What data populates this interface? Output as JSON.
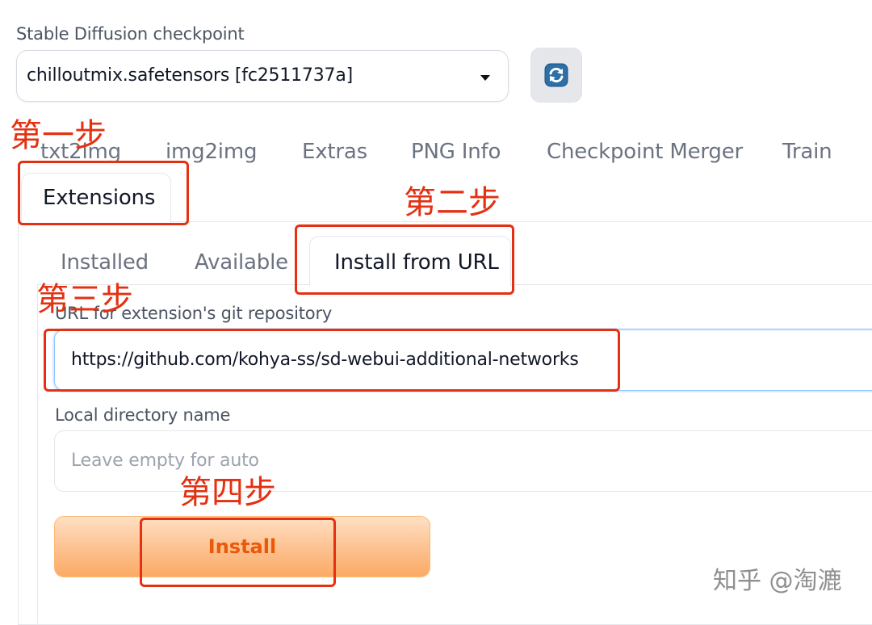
{
  "checkpoint": {
    "label": "Stable Diffusion checkpoint",
    "value": "chilloutmix.safetensors [fc2511737a]",
    "refresh_icon": "refresh-icon"
  },
  "main_tabs": [
    "txt2img",
    "img2img",
    "Extras",
    "PNG Info",
    "Checkpoint Merger",
    "Train",
    "Extensions"
  ],
  "active_main_tab": "Extensions",
  "extension_tabs": [
    "Installed",
    "Available",
    "Install from URL"
  ],
  "active_extension_tab": "Install from URL",
  "form": {
    "url_label": "URL for extension's git repository",
    "url_value": "https://github.com/kohya-ss/sd-webui-additional-networks",
    "dir_label": "Local directory name",
    "dir_placeholder": "Leave empty for auto",
    "install_label": "Install"
  },
  "annotations": {
    "step1": "第一步",
    "step2": "第二步",
    "step3": "第三步",
    "step4": "第四步",
    "color": "#e53012"
  },
  "watermark": "知乎 @淘漉",
  "colors": {
    "install_text": "#ea580c",
    "install_bg": "#fdc08e",
    "focus_border": "#93c5fd"
  }
}
